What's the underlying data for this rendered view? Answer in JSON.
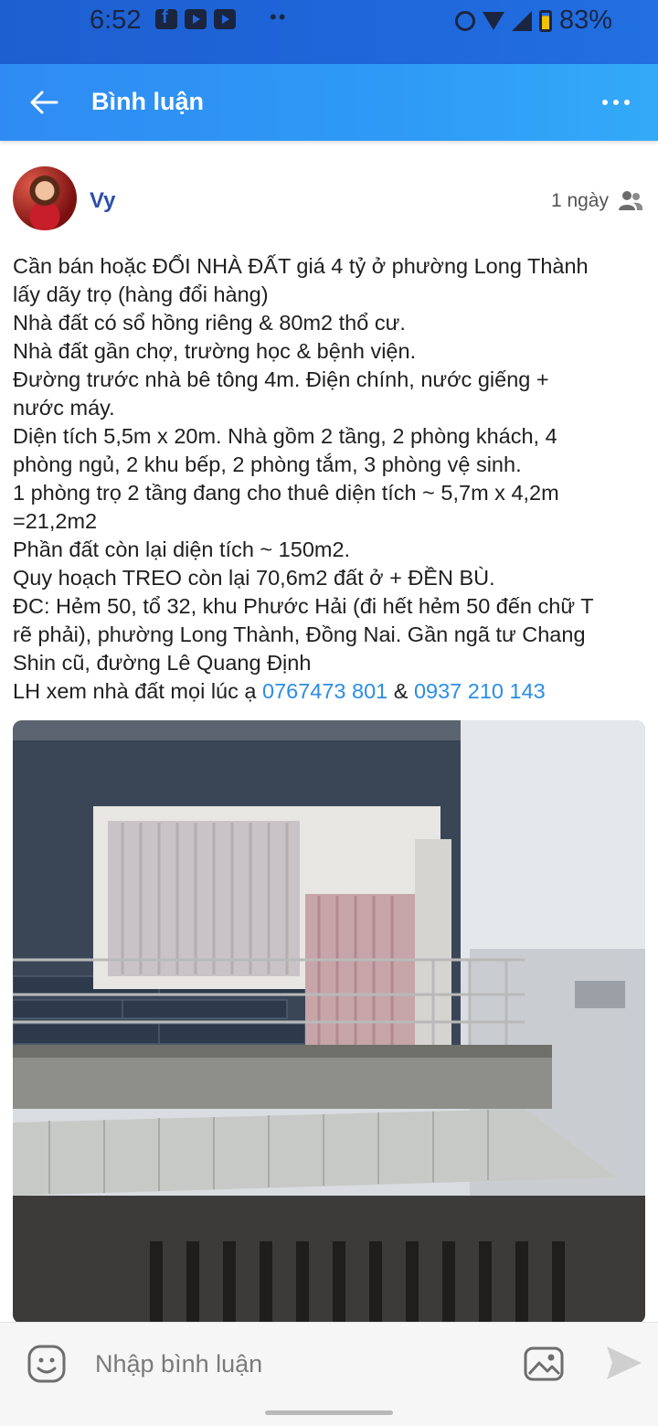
{
  "status_bar": {
    "time": "6:52",
    "dots": "••",
    "battery": "83%",
    "icons": [
      "facebook-icon",
      "youtube-icon",
      "youtube-icon",
      "sync-icon",
      "wifi-icon",
      "signal-icon",
      "battery-icon"
    ]
  },
  "app_bar": {
    "title": "Bình luận",
    "back_icon": "arrow-left-icon",
    "more_icon": "more-horizontal-icon"
  },
  "post": {
    "author": "Vy",
    "time": "1 ngày",
    "privacy_icon": "friends-icon",
    "lines": [
      "Cần bán hoặc ĐỔI NHÀ ĐẤT giá 4 tỷ ở phường Long Thành",
      "lấy dãy trọ (hàng đổi hàng)",
      "Nhà đất có sổ hồng riêng & 80m2 thổ cư.",
      "Nhà đất gần chợ, trường học & bệnh viện.",
      "Đường trước nhà bê tông 4m. Điện chính, nước giếng +",
      "nước máy.",
      "Diện tích 5,5m x 20m. Nhà gồm 2 tầng, 2 phòng khách, 4",
      "phòng ngủ, 2 khu bếp, 2 phòng tắm, 3 phòng vệ sinh.",
      "1 phòng trọ 2 tầng đang cho thuê diện tích ~ 5,7m x 4,2m",
      "=21,2m2",
      "Phần đất còn lại diện tích ~ 150m2.",
      "Quy hoạch TREO còn lại 70,6m2 đất ở + ĐỀN BÙ.",
      "ĐC: Hẻm 50, tổ 32, khu Phước Hải (đi hết hẻm 50 đến chữ T",
      "rẽ phải), phường Long Thành, Đồng Nai. Gần ngã tư Chang",
      "Shin cũ, đường Lê Quang Định"
    ],
    "contact_prefix": "LH xem nhà đất mọi lúc ạ ",
    "phone1": "0767473 801",
    "contact_and": " & ",
    "phone2": "0937 210 143"
  },
  "comment_bar": {
    "placeholder": "Nhập bình luận",
    "emoji_icon": "emoji-icon",
    "image_icon": "image-icon",
    "send_icon": "send-icon"
  }
}
